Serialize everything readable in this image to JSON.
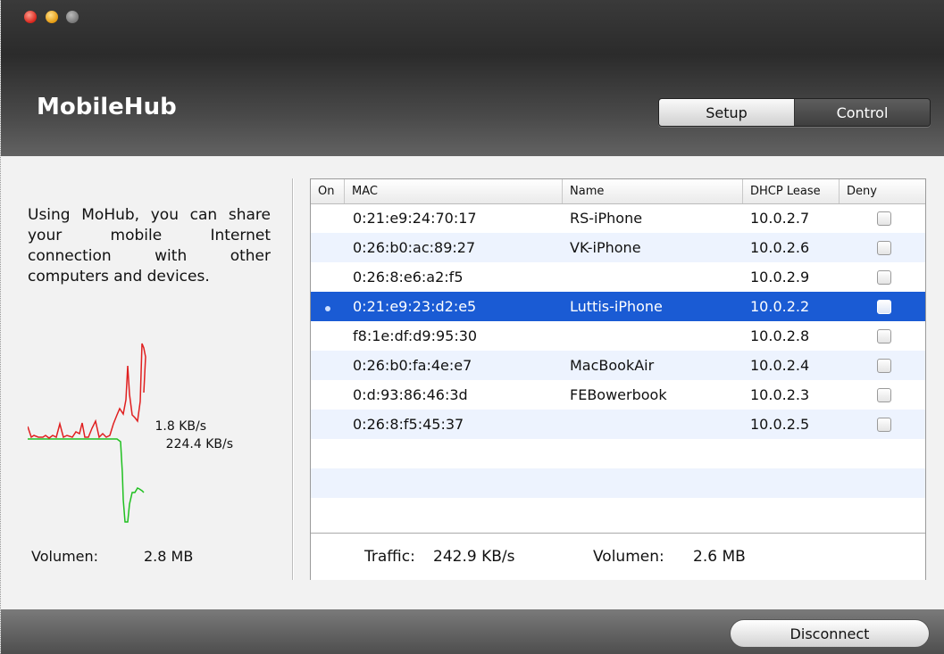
{
  "window": {
    "title": "MobileHub",
    "controls": [
      "close-icon",
      "minimize-icon",
      "zoom-icon"
    ]
  },
  "segmented": {
    "options": [
      "Setup",
      "Control"
    ],
    "selected": "Control"
  },
  "description": "Using MoHub, you can share your mobile Internet connection with other computers and devices.",
  "graph": {
    "upload_rate": "1.8 KB/s",
    "download_rate": "224.4 KB/s",
    "colors": {
      "upload": "#e02020",
      "download": "#20c020"
    }
  },
  "left_volume": {
    "label": "Volumen:",
    "value": "2.8 MB"
  },
  "table": {
    "columns": [
      "On",
      "MAC",
      "Name",
      "DHCP Lease",
      "Deny"
    ],
    "rows": [
      {
        "on": "",
        "mac": "0:21:e9:24:70:17",
        "name": "RS-iPhone",
        "lease": "10.0.2.7",
        "deny": false
      },
      {
        "on": "",
        "mac": "0:26:b0:ac:89:27",
        "name": "VK-iPhone",
        "lease": "10.0.2.6",
        "deny": false
      },
      {
        "on": "",
        "mac": "0:26:8:e6:a2:f5",
        "name": "",
        "lease": "10.0.2.9",
        "deny": false
      },
      {
        "on": "dot",
        "mac": "0:21:e9:23:d2:e5",
        "name": "Luttis-iPhone",
        "lease": "10.0.2.2",
        "deny": false,
        "selected": true
      },
      {
        "on": "",
        "mac": "f8:1e:df:d9:95:30",
        "name": "",
        "lease": "10.0.2.8",
        "deny": false
      },
      {
        "on": "",
        "mac": "0:26:b0:fa:4e:e7",
        "name": "MacBookAir",
        "lease": "10.0.2.4",
        "deny": false
      },
      {
        "on": "",
        "mac": "0:d:93:86:46:3d",
        "name": "FEBowerbook",
        "lease": "10.0.2.3",
        "deny": false
      },
      {
        "on": "",
        "mac": "0:26:8:f5:45:37",
        "name": "",
        "lease": "10.0.2.5",
        "deny": false
      }
    ],
    "empty_rows": 3
  },
  "footer": {
    "traffic_label": "Traffic:",
    "traffic_value": "242.9 KB/s",
    "volume_label": "Volumen:",
    "volume_value": "2.6 MB"
  },
  "actions": {
    "disconnect": "Disconnect"
  },
  "colors": {
    "selection": "#1a5bd4",
    "alt_row": "#edf3fe"
  }
}
